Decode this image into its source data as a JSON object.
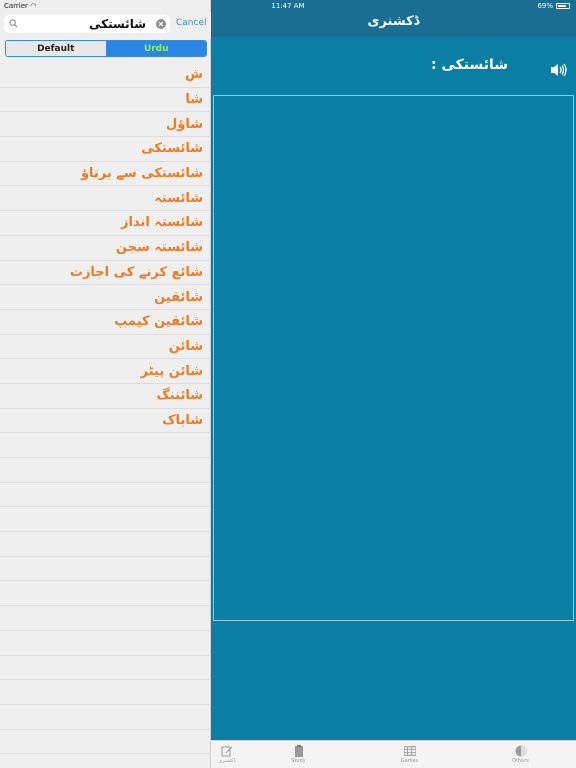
{
  "status": {
    "carrier": "Carrier",
    "time": "11:47 AM",
    "battery": "69%"
  },
  "header": {
    "title": "ڈکشنری"
  },
  "search": {
    "query": "شائستکی",
    "cancel_label": "Cancel"
  },
  "segments": {
    "default_label": "Default",
    "urdu_label": "Urdu",
    "selected": "Urdu"
  },
  "results": [
    "ش",
    "شا",
    "شاؤل",
    "شائستکی",
    "شائستکی سے برتاؤ",
    "شائستہ",
    "شائستہ انداز",
    "شائستہ سجن",
    "شائع کرنے کی اجازت",
    "شائقین",
    "شائقین کیمپ",
    "شائن",
    "شائن پیٹر",
    "شائننگ",
    "شاباک"
  ],
  "empty_rows": 14,
  "detail": {
    "word": "شائستکی :"
  },
  "tabs": [
    {
      "label": "ڈکشنری",
      "icon": "dictionary-icon"
    },
    {
      "label": "Study",
      "icon": "study-icon"
    },
    {
      "label": "Games",
      "icon": "games-icon"
    },
    {
      "label": "Others",
      "icon": "others-icon"
    }
  ],
  "colors": {
    "accent": "#3c8ad9",
    "word": "#f07a22",
    "detail_bg": "#0a7fa3",
    "header_bg": "#1a6e91",
    "urdu_text": "#8ff05c"
  }
}
